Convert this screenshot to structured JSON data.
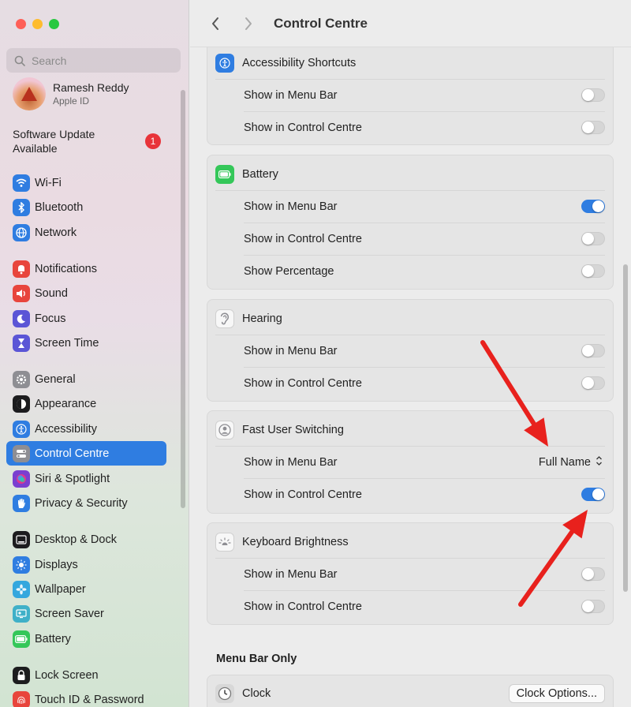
{
  "window": {
    "title": "Control Centre"
  },
  "sidebar": {
    "search_placeholder": "Search",
    "account": {
      "name": "Ramesh Reddy",
      "subtitle": "Apple ID"
    },
    "software_update": {
      "label": "Software Update Available",
      "badge": "1"
    },
    "items": [
      {
        "label": "Wi-Fi",
        "icon": "wifi-icon",
        "color": "#2f7de1"
      },
      {
        "label": "Bluetooth",
        "icon": "bluetooth-icon",
        "color": "#2f7de1"
      },
      {
        "label": "Network",
        "icon": "globe-icon",
        "color": "#2f7de1"
      },
      {
        "label": "Notifications",
        "icon": "bell-icon",
        "color": "#e8453c"
      },
      {
        "label": "Sound",
        "icon": "speaker-icon",
        "color": "#e8453c"
      },
      {
        "label": "Focus",
        "icon": "moon-icon",
        "color": "#5b55d6"
      },
      {
        "label": "Screen Time",
        "icon": "hourglass-icon",
        "color": "#5b55d6"
      },
      {
        "label": "General",
        "icon": "gear-icon",
        "color": "#8e8e93"
      },
      {
        "label": "Appearance",
        "icon": "appearance-icon",
        "color": "#1c1c1e"
      },
      {
        "label": "Accessibility",
        "icon": "accessibility-icon",
        "color": "#2f7de1"
      },
      {
        "label": "Control Centre",
        "icon": "control-centre-icon",
        "color": "#8e8e93"
      },
      {
        "label": "Siri & Spotlight",
        "icon": "siri-icon",
        "color": "#7a3fd0"
      },
      {
        "label": "Privacy & Security",
        "icon": "hand-icon",
        "color": "#2f7de1"
      },
      {
        "label": "Desktop & Dock",
        "icon": "dock-icon",
        "color": "#1c1c1e"
      },
      {
        "label": "Displays",
        "icon": "sun-icon",
        "color": "#2f7de1"
      },
      {
        "label": "Wallpaper",
        "icon": "flower-icon",
        "color": "#34a7de"
      },
      {
        "label": "Screen Saver",
        "icon": "screensaver-icon",
        "color": "#3fb0c8"
      },
      {
        "label": "Battery",
        "icon": "battery-icon",
        "color": "#34c759"
      },
      {
        "label": "Lock Screen",
        "icon": "lock-icon",
        "color": "#1c1c1e"
      },
      {
        "label": "Touch ID & Password",
        "icon": "fingerprint-icon",
        "color": "#e8453c"
      }
    ],
    "selected": "Control Centre"
  },
  "main": {
    "groups": [
      {
        "title": "Accessibility Shortcuts",
        "icon": "accessibility-icon",
        "icon_color": "#2f7de1",
        "rows": [
          {
            "label": "Show in Menu Bar",
            "on": false
          },
          {
            "label": "Show in Control Centre",
            "on": false
          }
        ]
      },
      {
        "title": "Battery",
        "icon": "battery-icon",
        "icon_color": "#34c759",
        "rows": [
          {
            "label": "Show in Menu Bar",
            "on": true
          },
          {
            "label": "Show in Control Centre",
            "on": false
          },
          {
            "label": "Show Percentage",
            "on": false
          }
        ]
      },
      {
        "title": "Hearing",
        "icon": "ear-icon",
        "icon_color": "#ffffff",
        "rows": [
          {
            "label": "Show in Menu Bar",
            "on": false
          },
          {
            "label": "Show in Control Centre",
            "on": false
          }
        ]
      },
      {
        "title": "Fast User Switching",
        "icon": "user-icon",
        "icon_color": "#ffffff",
        "rows": [
          {
            "label": "Show in Menu Bar",
            "select": "Full Name"
          },
          {
            "label": "Show in Control Centre",
            "on": true
          }
        ]
      },
      {
        "title": "Keyboard Brightness",
        "icon": "keyboard-brightness-icon",
        "icon_color": "#ffffff",
        "rows": [
          {
            "label": "Show in Menu Bar",
            "on": false
          },
          {
            "label": "Show in Control Centre",
            "on": false
          }
        ]
      }
    ],
    "menu_bar_only": {
      "section_title": "Menu Bar Only",
      "clock": {
        "title": "Clock",
        "button": "Clock Options..."
      }
    },
    "annotation_color": "#e8211d"
  }
}
